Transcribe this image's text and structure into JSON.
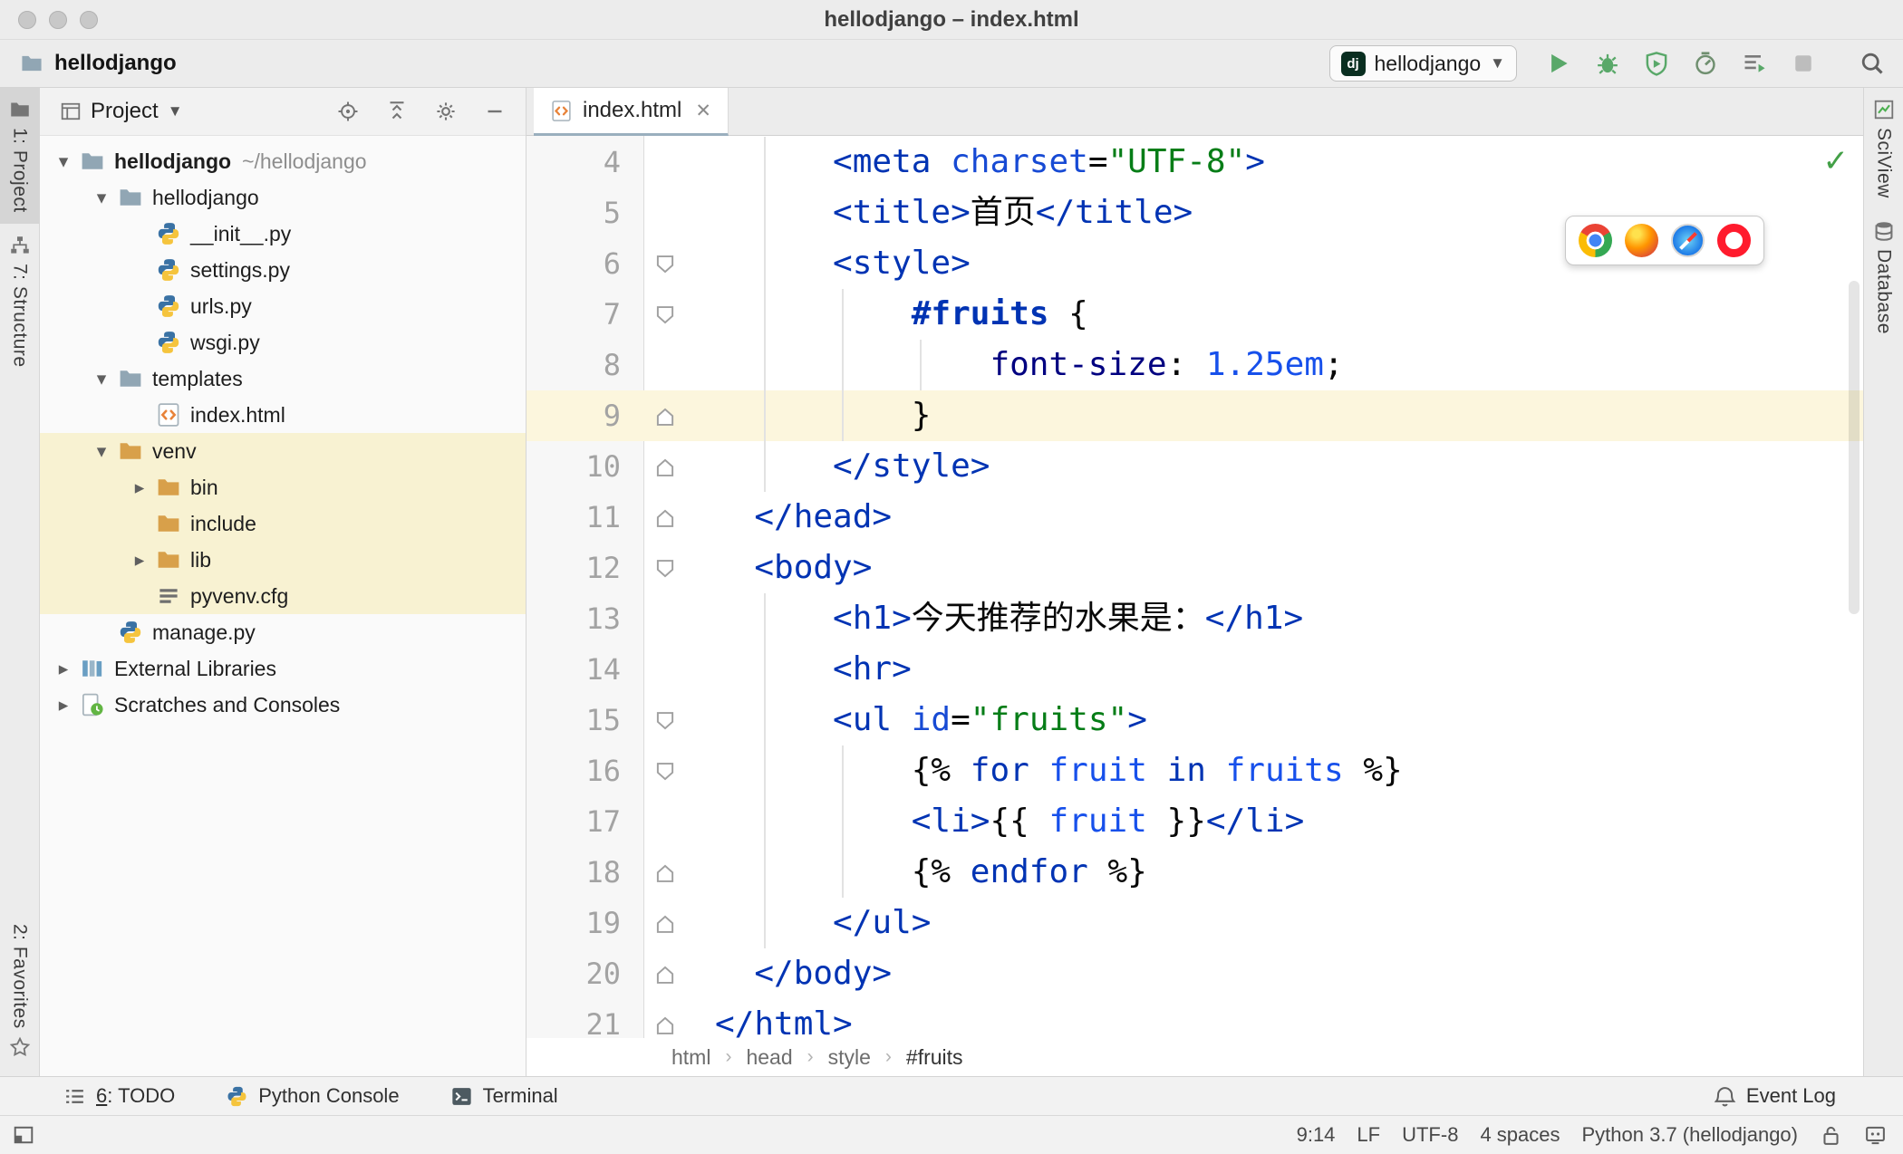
{
  "window": {
    "title": "hellodjango – index.html"
  },
  "toolbar": {
    "project_label": "hellodjango",
    "run_config_label": "hellodjango",
    "django_badge": "dj"
  },
  "left_stripe": {
    "project_tab": "1: Project",
    "structure_tab": "7: Structure",
    "favorites_tab": "2: Favorites"
  },
  "right_stripe": {
    "sciview_tab": "SciView",
    "database_tab": "Database"
  },
  "project_panel": {
    "header_title": "Project",
    "tree": [
      {
        "level": 0,
        "chevron": "down",
        "icon": "folder",
        "label": "hellodjango",
        "bold": true,
        "annotation": "~/hellodjango"
      },
      {
        "level": 1,
        "chevron": "down",
        "icon": "folder",
        "label": "hellodjango"
      },
      {
        "level": 2,
        "chevron": null,
        "icon": "python",
        "label": "__init__.py"
      },
      {
        "level": 2,
        "chevron": null,
        "icon": "python",
        "label": "settings.py"
      },
      {
        "level": 2,
        "chevron": null,
        "icon": "python",
        "label": "urls.py"
      },
      {
        "level": 2,
        "chevron": null,
        "icon": "python",
        "label": "wsgi.py"
      },
      {
        "level": 1,
        "chevron": "down",
        "icon": "folder",
        "label": "templates"
      },
      {
        "level": 2,
        "chevron": null,
        "icon": "html",
        "label": "index.html"
      },
      {
        "level": 1,
        "chevron": "down",
        "icon": "folder-excluded",
        "label": "venv",
        "highlighted": true
      },
      {
        "level": 2,
        "chevron": "right",
        "icon": "folder-excluded",
        "label": "bin",
        "highlighted": true
      },
      {
        "level": 2,
        "chevron": null,
        "icon": "folder-excluded",
        "label": "include",
        "highlighted": true
      },
      {
        "level": 2,
        "chevron": "right",
        "icon": "folder-excluded",
        "label": "lib",
        "highlighted": true
      },
      {
        "level": 2,
        "chevron": null,
        "icon": "textfile",
        "label": "pyvenv.cfg",
        "highlighted": true
      },
      {
        "level": 1,
        "chevron": null,
        "icon": "python",
        "label": "manage.py"
      },
      {
        "level": 0,
        "chevron": "right",
        "icon": "libraries",
        "label": "External Libraries"
      },
      {
        "level": 0,
        "chevron": "right",
        "icon": "scratches",
        "label": "Scratches and Consoles"
      }
    ]
  },
  "editor": {
    "tab_label": "index.html",
    "breadcrumbs": [
      "html",
      "head",
      "style",
      "#fruits"
    ],
    "current_line": 9,
    "lines": [
      {
        "n": 4,
        "tokens": [
          [
            "plain",
            "      "
          ],
          [
            "tag",
            "<meta "
          ],
          [
            "attr",
            "charset"
          ],
          [
            "plain",
            "="
          ],
          [
            "str",
            "\"UTF-8\""
          ],
          [
            "tag",
            ">"
          ]
        ]
      },
      {
        "n": 5,
        "tokens": [
          [
            "plain",
            "      "
          ],
          [
            "tag",
            "<title>"
          ],
          [
            "plain",
            "首页"
          ],
          [
            "tag",
            "</title>"
          ]
        ]
      },
      {
        "n": 6,
        "fold": "start",
        "tokens": [
          [
            "plain",
            "      "
          ],
          [
            "tag",
            "<style>"
          ]
        ]
      },
      {
        "n": 7,
        "fold": "start",
        "tokens": [
          [
            "plain",
            "          "
          ],
          [
            "sel",
            "#fruits "
          ],
          [
            "plain",
            "{"
          ]
        ]
      },
      {
        "n": 8,
        "tokens": [
          [
            "plain",
            "              "
          ],
          [
            "prop",
            "font-size"
          ],
          [
            "plain",
            ": "
          ],
          [
            "num",
            "1.25em"
          ],
          [
            "plain",
            ";"
          ]
        ]
      },
      {
        "n": 9,
        "fold": "end",
        "current": true,
        "tokens": [
          [
            "plain",
            "          }"
          ]
        ]
      },
      {
        "n": 10,
        "fold": "end",
        "tokens": [
          [
            "plain",
            "      "
          ],
          [
            "tag",
            "</style>"
          ]
        ]
      },
      {
        "n": 11,
        "fold": "end",
        "tokens": [
          [
            "plain",
            "  "
          ],
          [
            "tag",
            "</head>"
          ]
        ]
      },
      {
        "n": 12,
        "fold": "start",
        "tokens": [
          [
            "plain",
            "  "
          ],
          [
            "tag",
            "<body>"
          ]
        ]
      },
      {
        "n": 13,
        "tokens": [
          [
            "plain",
            "      "
          ],
          [
            "tag",
            "<h1>"
          ],
          [
            "plain",
            "今天推荐的水果是："
          ],
          [
            "tag",
            "</h1>"
          ]
        ]
      },
      {
        "n": 14,
        "tokens": [
          [
            "plain",
            "      "
          ],
          [
            "tag",
            "<hr>"
          ]
        ]
      },
      {
        "n": 15,
        "fold": "start",
        "tokens": [
          [
            "plain",
            "      "
          ],
          [
            "tag",
            "<ul "
          ],
          [
            "attr",
            "id"
          ],
          [
            "plain",
            "="
          ],
          [
            "str",
            "\"fruits\""
          ],
          [
            "tag",
            ">"
          ]
        ]
      },
      {
        "n": 16,
        "fold": "start",
        "tokens": [
          [
            "plain",
            "          "
          ],
          [
            "plain",
            "{% "
          ],
          [
            "kw",
            "for"
          ],
          [
            "plain",
            " "
          ],
          [
            "var",
            "fruit"
          ],
          [
            "plain",
            " "
          ],
          [
            "kw",
            "in"
          ],
          [
            "plain",
            " "
          ],
          [
            "var",
            "fruits"
          ],
          [
            "plain",
            " %}"
          ]
        ]
      },
      {
        "n": 17,
        "tokens": [
          [
            "plain",
            "          "
          ],
          [
            "tag",
            "<li>"
          ],
          [
            "plain",
            "{{ "
          ],
          [
            "var",
            "fruit"
          ],
          [
            "plain",
            " }}"
          ],
          [
            "tag",
            "</li>"
          ]
        ]
      },
      {
        "n": 18,
        "fold": "end",
        "tokens": [
          [
            "plain",
            "          "
          ],
          [
            "plain",
            "{% "
          ],
          [
            "kw",
            "endfor"
          ],
          [
            "plain",
            " %}"
          ]
        ]
      },
      {
        "n": 19,
        "fold": "end",
        "tokens": [
          [
            "plain",
            "      "
          ],
          [
            "tag",
            "</ul>"
          ]
        ]
      },
      {
        "n": 20,
        "fold": "end",
        "tokens": [
          [
            "plain",
            "  "
          ],
          [
            "tag",
            "</body>"
          ]
        ]
      },
      {
        "n": 21,
        "fold": "end",
        "tokens": [
          [
            "tag",
            "</html>"
          ]
        ]
      }
    ],
    "guides": [
      {
        "col": 2,
        "from": 4,
        "to": 10
      },
      {
        "col": 6,
        "from": 7,
        "to": 9
      },
      {
        "col": 10,
        "from": 8,
        "to": 8
      },
      {
        "col": 2,
        "from": 13,
        "to": 19
      },
      {
        "col": 6,
        "from": 16,
        "to": 18
      }
    ]
  },
  "browser_popup": [
    "chrome",
    "firefox",
    "safari",
    "opera"
  ],
  "bottom_bar": {
    "todo_num": "6",
    "todo_rest": ": TODO",
    "python_console": "Python Console",
    "terminal": "Terminal",
    "event_log": "Event Log"
  },
  "status_bar": {
    "position": "9:14",
    "line_separator": "LF",
    "encoding": "UTF-8",
    "indent": "4 spaces",
    "interpreter": "Python 3.7 (hellodjango)"
  },
  "colors": {
    "c-tag": "#0033b3",
    "c-attr": "#174ad4",
    "c-str": "#067d17",
    "c-kw": "#0033b3",
    "c-var": "#1750eb",
    "c-num": "#1750eb",
    "c-prop": "#000080",
    "c-sel": "#0033b3",
    "c-plain": "#080808",
    "caret-row": "#fcf6dd",
    "tree-hl": "#f8f2d2",
    "tab-underline": "#9aafbe",
    "run-green": "#59a869"
  }
}
